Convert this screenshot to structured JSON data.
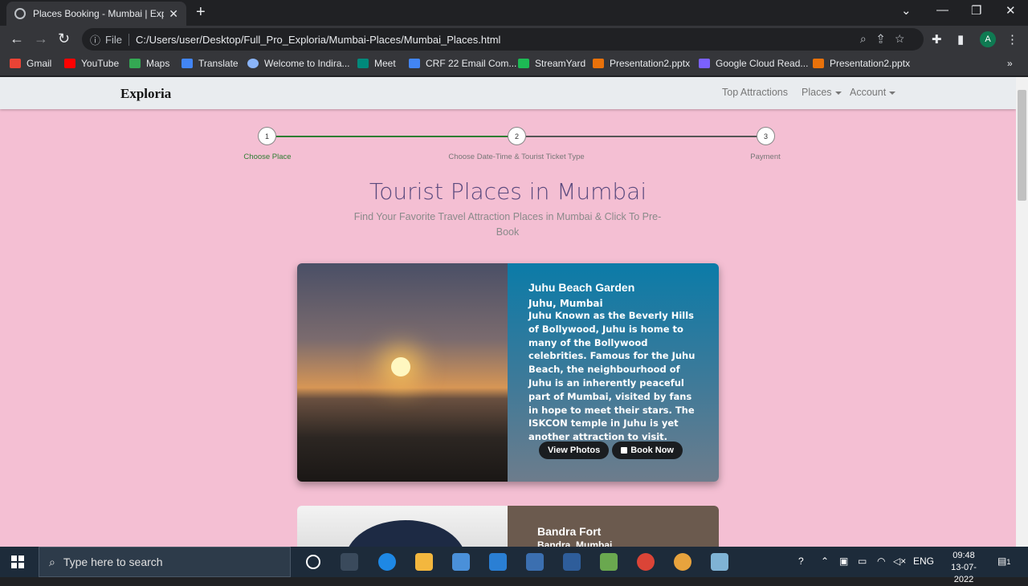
{
  "browser": {
    "tab_title": "Places Booking - Mumbai | Exploria",
    "tab_close": "✕",
    "new_tab": "+",
    "file_label": "File",
    "url": "C:/Users/user/Desktop/Full_Pro_Exploria/Mumbai-Places/Mumbai_Places.html",
    "avatar": "A",
    "bookmarks": [
      "Gmail",
      "YouTube",
      "Maps",
      "Translate",
      "Welcome to Indira...",
      "Meet",
      "CRF 22 Email Com...",
      "StreamYard",
      "Presentation2.pptx",
      "Google Cloud Read...",
      "Presentation2.pptx"
    ],
    "bookmark_colors": [
      "#ea4335",
      "#ff0000",
      "#34a853",
      "#4285f4",
      "#8ab4f8",
      "#00897b",
      "#4285f4",
      "#1db954",
      "#e8710a",
      "#7b61ff",
      "#e8710a"
    ]
  },
  "navbar": {
    "brand": "Exploria",
    "links": [
      "Top Attractions",
      "Places",
      "Account"
    ]
  },
  "steps": {
    "numbers": [
      "1",
      "2",
      "3"
    ],
    "labels": [
      "Choose Place",
      "Choose Date-Time & Tourist Ticket Type",
      "Payment"
    ],
    "active_color": "#2e7d32",
    "inactive_color": "#555555"
  },
  "header": {
    "title": "Tourist Places in Mumbai",
    "subtitle": "Find Your Favorite Travel Attraction Places in Mumbai & Click To Pre-Book"
  },
  "places": [
    {
      "name": "Juhu Beach Garden",
      "location": "Juhu, Mumbai",
      "description": "Juhu Known as the Beverly Hills of Bollywood, Juhu is home to many of the Bollywood celebrities. Famous for the Juhu Beach, the neighbourhood of Juhu is an inherently peaceful part of Mumbai, visited by fans in hope to meet their stars. The ISKCON temple in Juhu is yet another attraction to visit.",
      "view_photos": "View Photos",
      "book_now": "Book Now"
    },
    {
      "name": "Bandra Fort",
      "location": "Bandra, Mumbai"
    }
  ],
  "taskbar": {
    "search_placeholder": "Type here to search",
    "language": "ENG",
    "time": "09:48",
    "date": "13-07-2022",
    "notification_count": "1"
  }
}
